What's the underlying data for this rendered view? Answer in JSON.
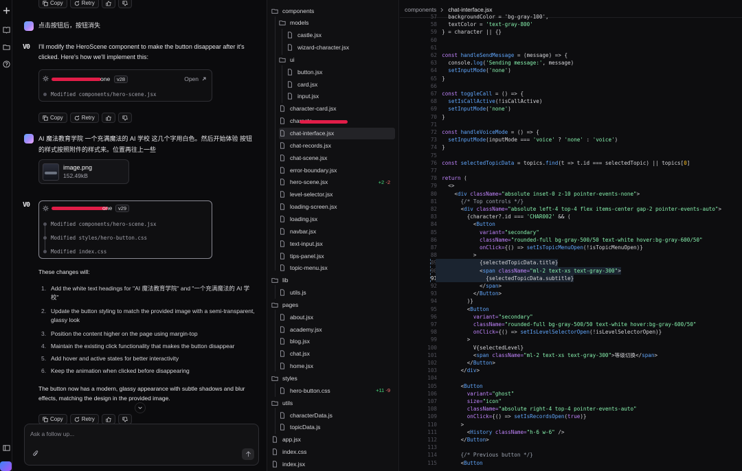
{
  "rail": {
    "icons": [
      "plus-icon",
      "book-icon",
      "folder-icon",
      "help-icon",
      "panel-icon"
    ]
  },
  "chat": {
    "actions": {
      "copy": "Copy",
      "retry": "Retry"
    },
    "user_msg_1": "点击按钮后，按钮消失",
    "assistant_msg_1": "I'll modify the HeroScene component to make the button disappear after it's clicked. Here's how we'll implement this:",
    "card1": {
      "name_suffix": "one",
      "version": "v28",
      "open_label": "Open",
      "files": [
        "Modified components/hero-scene.jsx"
      ]
    },
    "user_msg_2": "AI 魔法教育学院 一个充满魔法的 AI 学校 这几个字用白色。然后开始体验 按钮的样式按照附件的样式来。位置再往上一些",
    "attachment": {
      "name": "image.png",
      "size": "152.49kB"
    },
    "card2": {
      "name_suffix": "one",
      "version": "v29",
      "files": [
        "Modified components/hero-scene.jsx",
        "Modified styles/hero-button.css",
        "Modified index.css"
      ]
    },
    "changes_intro": "These changes will:",
    "changes": [
      "Add the white text headings for \"AI 魔法教育学院\" and \"一个充满魔法的 AI 学校\"",
      "Update the button styling to match the provided image with a semi-transparent, glassy look",
      "Position the content higher on the page using margin-top",
      "Maintain the existing click functionality that makes the button disappear",
      "Add hover and active states for better interactivity",
      "Keep the animation when clicked before disappearing"
    ],
    "summary": "The button now has a modern, glassy appearance with subtle shadows and blur effects, matching the design in the provided image.",
    "input_placeholder": "Ask a follow up..."
  },
  "explorer": {
    "items": [
      {
        "label": "components",
        "type": "folder",
        "depth": 0
      },
      {
        "label": "models",
        "type": "folder",
        "depth": 1
      },
      {
        "label": "castle.jsx",
        "type": "file",
        "depth": 2
      },
      {
        "label": "wizard-character.jsx",
        "type": "file",
        "depth": 2
      },
      {
        "label": "ui",
        "type": "folder",
        "depth": 1
      },
      {
        "label": "button.jsx",
        "type": "file",
        "depth": 2
      },
      {
        "label": "card.jsx",
        "type": "file",
        "depth": 2
      },
      {
        "label": "input.jsx",
        "type": "file",
        "depth": 2
      },
      {
        "label": "character-card.jsx",
        "type": "file",
        "depth": 1
      },
      {
        "label": "characte",
        "type": "file",
        "depth": 1,
        "redacted": true
      },
      {
        "label": "chat-interface.jsx",
        "type": "file",
        "depth": 1,
        "active": true
      },
      {
        "label": "chat-records.jsx",
        "type": "file",
        "depth": 1
      },
      {
        "label": "chat-scene.jsx",
        "type": "file",
        "depth": 1
      },
      {
        "label": "error-boundary.jsx",
        "type": "file",
        "depth": 1
      },
      {
        "label": "hero-scene.jsx",
        "type": "file",
        "depth": 1,
        "added": "+2",
        "removed": "-2"
      },
      {
        "label": "level-selector.jsx",
        "type": "file",
        "depth": 1
      },
      {
        "label": "loading-screen.jsx",
        "type": "file",
        "depth": 1
      },
      {
        "label": "loading.jsx",
        "type": "file",
        "depth": 1
      },
      {
        "label": "navbar.jsx",
        "type": "file",
        "depth": 1
      },
      {
        "label": "text-input.jsx",
        "type": "file",
        "depth": 1
      },
      {
        "label": "tips-panel.jsx",
        "type": "file",
        "depth": 1
      },
      {
        "label": "topic-menu.jsx",
        "type": "file",
        "depth": 1
      },
      {
        "label": "lib",
        "type": "folder",
        "depth": 0
      },
      {
        "label": "utils.js",
        "type": "file",
        "depth": 1
      },
      {
        "label": "pages",
        "type": "folder",
        "depth": 0
      },
      {
        "label": "about.jsx",
        "type": "file",
        "depth": 1
      },
      {
        "label": "academy.jsx",
        "type": "file",
        "depth": 1
      },
      {
        "label": "blog.jsx",
        "type": "file",
        "depth": 1
      },
      {
        "label": "chat.jsx",
        "type": "file",
        "depth": 1
      },
      {
        "label": "home.jsx",
        "type": "file",
        "depth": 1
      },
      {
        "label": "styles",
        "type": "folder",
        "depth": 0
      },
      {
        "label": "hero-button.css",
        "type": "file",
        "depth": 1,
        "added": "+11",
        "removed": "-9"
      },
      {
        "label": "utils",
        "type": "folder",
        "depth": 0
      },
      {
        "label": "characterData.js",
        "type": "file",
        "depth": 1
      },
      {
        "label": "topicData.js",
        "type": "file",
        "depth": 1
      },
      {
        "label": "app.jsx",
        "type": "file",
        "depth": 0
      },
      {
        "label": "index.css",
        "type": "file",
        "depth": 0
      },
      {
        "label": "index.jsx",
        "type": "file",
        "depth": 0
      }
    ]
  },
  "editor": {
    "breadcrumb": {
      "folder": "components",
      "file": "chat-interface.jsx"
    },
    "current_line": 91,
    "lines": [
      {
        "n": 57,
        "t": [
          [
            "    backgroundColor = 'bg-gray-100',",
            "t-pl"
          ]
        ]
      },
      {
        "n": 58,
        "t": [
          [
            "    textColor = ",
            "t-pl"
          ],
          [
            "'text-gray-800'",
            "t-str"
          ]
        ]
      },
      {
        "n": 59,
        "t": [
          [
            "  } = character || {}",
            "t-pl"
          ]
        ]
      },
      {
        "n": 60,
        "t": []
      },
      {
        "n": 61,
        "t": []
      },
      {
        "n": 62,
        "t": [
          [
            "  const ",
            "t-kw"
          ],
          [
            "handleSendMessage",
            "t-fn"
          ],
          [
            " = (message) => {",
            "t-pl"
          ]
        ]
      },
      {
        "n": 63,
        "t": [
          [
            "    console.",
            "t-pl"
          ],
          [
            "log",
            "t-fn"
          ],
          [
            "(",
            "t-pl"
          ],
          [
            "'Sending message:'",
            "t-str"
          ],
          [
            ", message)",
            "t-pl"
          ]
        ]
      },
      {
        "n": 64,
        "t": [
          [
            "    ",
            "t-pl"
          ],
          [
            "setInputMode",
            "t-fn"
          ],
          [
            "(",
            "t-pl"
          ],
          [
            "'none'",
            "t-str"
          ],
          [
            ")",
            "t-pl"
          ]
        ]
      },
      {
        "n": 65,
        "t": [
          [
            "  }",
            "t-pl"
          ]
        ]
      },
      {
        "n": 66,
        "t": []
      },
      {
        "n": 67,
        "t": [
          [
            "  const ",
            "t-kw"
          ],
          [
            "toggleCall",
            "t-fn"
          ],
          [
            " = () => {",
            "t-pl"
          ]
        ]
      },
      {
        "n": 68,
        "t": [
          [
            "    ",
            "t-pl"
          ],
          [
            "setIsCallActive",
            "t-fn"
          ],
          [
            "(!isCallActive)",
            "t-pl"
          ]
        ]
      },
      {
        "n": 69,
        "t": [
          [
            "    ",
            "t-pl"
          ],
          [
            "setInputMode",
            "t-fn"
          ],
          [
            "(",
            "t-pl"
          ],
          [
            "'none'",
            "t-str"
          ],
          [
            ")",
            "t-pl"
          ]
        ]
      },
      {
        "n": 70,
        "t": [
          [
            "  }",
            "t-pl"
          ]
        ]
      },
      {
        "n": 71,
        "t": []
      },
      {
        "n": 72,
        "t": [
          [
            "  const ",
            "t-kw"
          ],
          [
            "handleVoiceMode",
            "t-fn"
          ],
          [
            " = () => {",
            "t-pl"
          ]
        ]
      },
      {
        "n": 73,
        "t": [
          [
            "    ",
            "t-pl"
          ],
          [
            "setInputMode",
            "t-fn"
          ],
          [
            "(inputMode === ",
            "t-pl"
          ],
          [
            "'voice'",
            "t-str"
          ],
          [
            " ? ",
            "t-pl"
          ],
          [
            "'none'",
            "t-str"
          ],
          [
            " : ",
            "t-pl"
          ],
          [
            "'voice'",
            "t-str"
          ],
          [
            ")",
            "t-pl"
          ]
        ]
      },
      {
        "n": 74,
        "t": [
          [
            "  }",
            "t-pl"
          ]
        ]
      },
      {
        "n": 75,
        "t": []
      },
      {
        "n": 76,
        "t": [
          [
            "  const ",
            "t-kw"
          ],
          [
            "selectedTopicData",
            "t-fn"
          ],
          [
            " = topics.",
            "t-pl"
          ],
          [
            "find",
            "t-fn"
          ],
          [
            "(t => t.id === selectedTopic) || topics[",
            "t-pl"
          ],
          [
            "0",
            "t-num"
          ],
          [
            "]",
            "t-pl"
          ]
        ]
      },
      {
        "n": 77,
        "t": []
      },
      {
        "n": 78,
        "t": [
          [
            "  return ",
            "t-kw"
          ],
          [
            "(",
            "t-pl"
          ]
        ]
      },
      {
        "n": 79,
        "t": [
          [
            "    <>",
            "t-pl"
          ]
        ]
      },
      {
        "n": 80,
        "t": [
          [
            "      <",
            "t-pl"
          ],
          [
            "div",
            "t-tag"
          ],
          [
            " className=",
            "t-at"
          ],
          [
            "\"absolute inset-0 z-10 pointer-events-none\"",
            "t-str"
          ],
          [
            ">",
            "t-pl"
          ]
        ]
      },
      {
        "n": 81,
        "t": [
          [
            "        {/* Top controls */}",
            "t-cm"
          ]
        ]
      },
      {
        "n": 82,
        "t": [
          [
            "        <",
            "t-pl"
          ],
          [
            "div",
            "t-tag"
          ],
          [
            " className=",
            "t-at"
          ],
          [
            "\"absolute left-4 top-4 flex items-center gap-2 pointer-events-auto\"",
            "t-str"
          ],
          [
            ">",
            "t-pl"
          ]
        ]
      },
      {
        "n": 83,
        "t": [
          [
            "          {character?.id === ",
            "t-pl"
          ],
          [
            "'CHAR002'",
            "t-str"
          ],
          [
            " && (",
            "t-pl"
          ]
        ]
      },
      {
        "n": 84,
        "t": [
          [
            "            <",
            "t-pl"
          ],
          [
            "Button",
            "t-tag"
          ]
        ]
      },
      {
        "n": 85,
        "t": [
          [
            "              variant=",
            "t-at"
          ],
          [
            "\"secondary\"",
            "t-str"
          ]
        ]
      },
      {
        "n": 86,
        "t": [
          [
            "              className=",
            "t-at"
          ],
          [
            "\"rounded-full bg-gray-500/50 text-white hover:bg-gray-600/50\"",
            "t-str"
          ]
        ]
      },
      {
        "n": 87,
        "t": [
          [
            "              onClick=",
            "t-at"
          ],
          [
            "{() => ",
            "t-pl"
          ],
          [
            "setIsTopicMenuOpen",
            "t-fn"
          ],
          [
            "(!isTopicMenuOpen)}",
            "t-pl"
          ]
        ]
      },
      {
        "n": 88,
        "t": [
          [
            "            >",
            "t-pl"
          ]
        ]
      },
      {
        "n": 89,
        "t": [
          [
            "              {selectedTopicData.title}",
            "t-pl"
          ]
        ]
      },
      {
        "n": 90,
        "t": [
          [
            "              <",
            "t-pl"
          ],
          [
            "span",
            "t-tag"
          ],
          [
            " className=",
            "t-at"
          ],
          [
            "\"ml-2 text-xs text-gray-300\"",
            "t-str"
          ],
          [
            ">",
            "t-pl"
          ]
        ]
      },
      {
        "n": 91,
        "t": [
          [
            "                {selectedTopicData.subtitle}",
            "t-pl"
          ]
        ]
      },
      {
        "n": 92,
        "t": [
          [
            "              </",
            "t-pl"
          ],
          [
            "span",
            "t-tag"
          ],
          [
            ">",
            "t-pl"
          ]
        ]
      },
      {
        "n": 93,
        "t": [
          [
            "            </",
            "t-pl"
          ],
          [
            "Button",
            "t-tag"
          ],
          [
            ">",
            "t-pl"
          ]
        ]
      },
      {
        "n": 94,
        "t": [
          [
            "          )}",
            "t-pl"
          ]
        ]
      },
      {
        "n": 95,
        "t": [
          [
            "          <",
            "t-pl"
          ],
          [
            "Button",
            "t-tag"
          ]
        ]
      },
      {
        "n": 96,
        "t": [
          [
            "            variant=",
            "t-at"
          ],
          [
            "\"secondary\"",
            "t-str"
          ]
        ]
      },
      {
        "n": 97,
        "t": [
          [
            "            className=",
            "t-at"
          ],
          [
            "\"rounded-full bg-gray-500/50 text-white hover:bg-gray-600/50\"",
            "t-str"
          ]
        ]
      },
      {
        "n": 98,
        "t": [
          [
            "            onClick=",
            "t-at"
          ],
          [
            "{() => ",
            "t-pl"
          ],
          [
            "setIsLevelSelectorOpen",
            "t-fn"
          ],
          [
            "(!isLevelSelectorOpen)}",
            "t-pl"
          ]
        ]
      },
      {
        "n": 99,
        "t": [
          [
            "          >",
            "t-pl"
          ]
        ]
      },
      {
        "n": 100,
        "t": [
          [
            "            V{selectedLevel}",
            "t-pl"
          ]
        ]
      },
      {
        "n": 101,
        "t": [
          [
            "            <",
            "t-pl"
          ],
          [
            "span",
            "t-tag"
          ],
          [
            " className=",
            "t-at"
          ],
          [
            "\"ml-2 text-xs text-gray-300\"",
            "t-str"
          ],
          [
            ">等级切换</",
            "t-pl"
          ],
          [
            "span",
            "t-tag"
          ],
          [
            ">",
            "t-pl"
          ]
        ]
      },
      {
        "n": 102,
        "t": [
          [
            "          </",
            "t-pl"
          ],
          [
            "Button",
            "t-tag"
          ],
          [
            ">",
            "t-pl"
          ]
        ]
      },
      {
        "n": 103,
        "t": [
          [
            "        </",
            "t-pl"
          ],
          [
            "div",
            "t-tag"
          ],
          [
            ">",
            "t-pl"
          ]
        ]
      },
      {
        "n": 104,
        "t": []
      },
      {
        "n": 105,
        "t": [
          [
            "        <",
            "t-pl"
          ],
          [
            "Button",
            "t-tag"
          ]
        ]
      },
      {
        "n": 106,
        "t": [
          [
            "          variant=",
            "t-at"
          ],
          [
            "\"ghost\"",
            "t-str"
          ]
        ]
      },
      {
        "n": 107,
        "t": [
          [
            "          size=",
            "t-at"
          ],
          [
            "\"icon\"",
            "t-str"
          ]
        ]
      },
      {
        "n": 108,
        "t": [
          [
            "          className=",
            "t-at"
          ],
          [
            "\"absolute right-4 top-4 pointer-events-auto\"",
            "t-str"
          ]
        ]
      },
      {
        "n": 109,
        "t": [
          [
            "          onClick=",
            "t-at"
          ],
          [
            "{() => ",
            "t-pl"
          ],
          [
            "setIsRecordsOpen",
            "t-fn"
          ],
          [
            "(",
            "t-pl"
          ],
          [
            "true",
            "t-kw"
          ],
          [
            ")}",
            "t-pl"
          ]
        ]
      },
      {
        "n": 110,
        "t": [
          [
            "        >",
            "t-pl"
          ]
        ]
      },
      {
        "n": 111,
        "t": [
          [
            "          <",
            "t-pl"
          ],
          [
            "History",
            "t-tag"
          ],
          [
            " className=",
            "t-at"
          ],
          [
            "\"h-6 w-6\"",
            "t-str"
          ],
          [
            " />",
            "t-pl"
          ]
        ]
      },
      {
        "n": 112,
        "t": [
          [
            "        </",
            "t-pl"
          ],
          [
            "Button",
            "t-tag"
          ],
          [
            ">",
            "t-pl"
          ]
        ]
      },
      {
        "n": 113,
        "t": []
      },
      {
        "n": 114,
        "t": [
          [
            "        {/* Previous button */}",
            "t-cm"
          ]
        ]
      },
      {
        "n": 115,
        "t": [
          [
            "        <",
            "t-pl"
          ],
          [
            "Button",
            "t-tag"
          ]
        ]
      }
    ]
  }
}
